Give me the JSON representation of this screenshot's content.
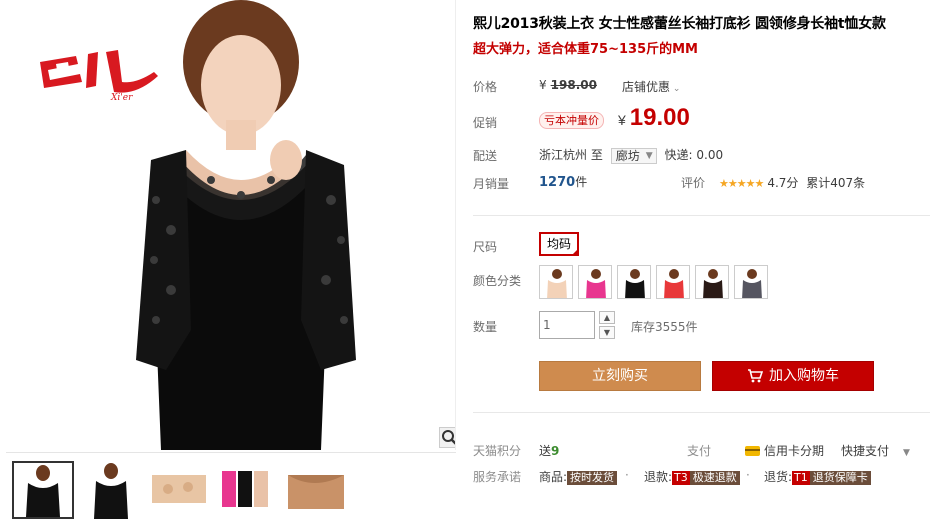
{
  "product": {
    "title": "熙儿2013秋装上衣 女士性感蕾丝长袖打底衫 圆领修身长袖t恤女款",
    "subtitle": "超大弹力，适合体重75~135斤的MM"
  },
  "brand": {
    "logo_text": "熙儿",
    "logo_sub": "Xi'er"
  },
  "price": {
    "label": "价格",
    "currency": "¥",
    "original": "198.00",
    "shop_discount": "店铺优惠"
  },
  "promo": {
    "label": "促销",
    "badge": "亏本冲量价",
    "currency": "¥",
    "price": "19.00"
  },
  "shipping": {
    "label": "配送",
    "from": "浙江杭州",
    "to_word": "至",
    "destination": "廊坊",
    "fee_label": "快递:",
    "fee": "0.00"
  },
  "sales": {
    "label": "月销量",
    "count": "1270",
    "unit": "件"
  },
  "rating": {
    "label": "评价",
    "stars": "★★★★★",
    "score": "4.7分",
    "total": "累计407条"
  },
  "size": {
    "label": "尺码",
    "option": "均码"
  },
  "colors": {
    "label": "颜色分类",
    "swatch_colors": [
      "#f3d2b8",
      "#e8368f",
      "#111111",
      "#e8383a",
      "#2a1a16",
      "#555560"
    ]
  },
  "quantity": {
    "label": "数量",
    "value": "1",
    "up": "▲",
    "down": "▼",
    "stock": "库存3555件"
  },
  "actions": {
    "buy": "立刻购买",
    "cart": "加入购物车"
  },
  "points": {
    "label": "天猫积分",
    "text": "送",
    "value": "9"
  },
  "payment": {
    "label": "支付",
    "card": "信用卡分期",
    "quick": "快捷支付"
  },
  "service": {
    "label": "服务承诺",
    "goods_label": "商品:",
    "goods_tag": "按时发货",
    "refund_label": "退款:",
    "refund_code": "T3",
    "refund_tag": "极速退款",
    "return_label": "退货:",
    "return_code": "T1",
    "return_tag": "退货保障卡"
  },
  "colors_theme": {
    "accent": "#c40000",
    "buy_button": "#cf8b4e",
    "link": "#21558d"
  }
}
